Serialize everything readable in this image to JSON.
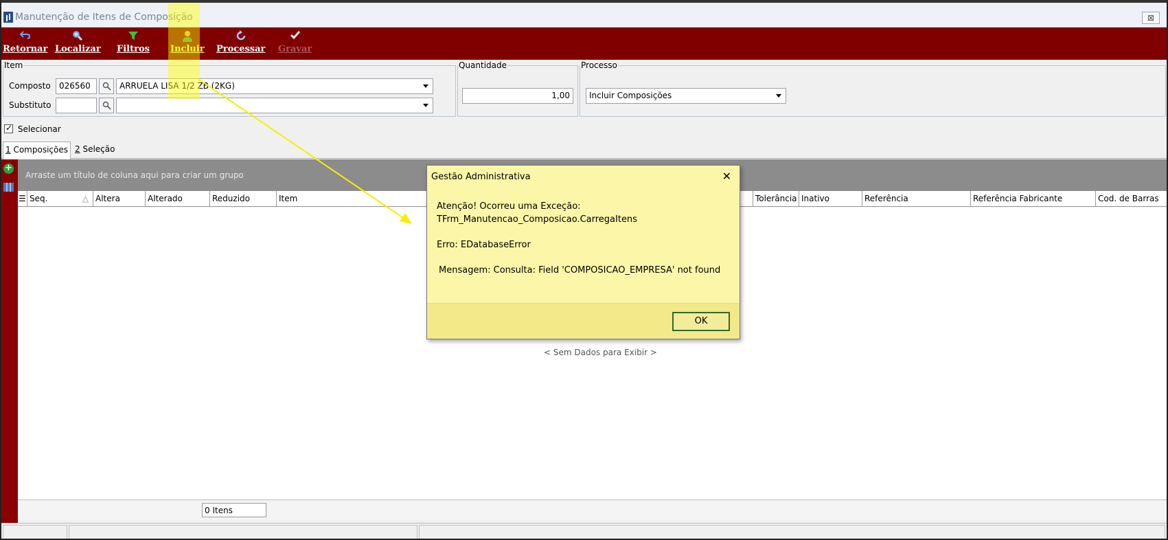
{
  "window": {
    "title": "Manutenção de Itens de Composição",
    "close_label": "⊠"
  },
  "toolbar": {
    "items": [
      {
        "label": "Retornar",
        "icon": "back-arrow-icon"
      },
      {
        "label": "Localizar",
        "icon": "magnifier-icon"
      },
      {
        "label": "Filtros",
        "icon": "funnel-icon"
      },
      {
        "label": "Incluir",
        "icon": "add-person-icon"
      },
      {
        "label": "Processar",
        "icon": "refresh-icon"
      },
      {
        "label": "Gravar",
        "icon": "checkmark-icon",
        "disabled": true
      }
    ]
  },
  "item_group": {
    "legend": "Item",
    "composto_label": "Composto",
    "composto_code": "026560",
    "composto_desc": "ARRUELA LISA 1/2 ZB (2KG)",
    "substituto_label": "Substituto",
    "substituto_code": "",
    "substituto_desc": ""
  },
  "quantidade_group": {
    "legend": "Quantidade",
    "value": "1,00"
  },
  "processo_group": {
    "legend": "Processo",
    "selected": "Incluir Composições"
  },
  "selecionar": {
    "label": "Selecionar",
    "checked": true
  },
  "tabs": [
    {
      "key": "1",
      "label": " Composições"
    },
    {
      "key": "2",
      "label": " Seleção"
    }
  ],
  "grid": {
    "group_hint": "Arraste um título de coluna aqui para criar um grupo",
    "columns": [
      "Seq.",
      "Altera",
      "Alterado",
      "Reduzido",
      "Item",
      "Tolerância",
      "Inativo",
      "Referência",
      "Referência Fabricante",
      "Cod. de Barras"
    ],
    "no_data": "< Sem Dados para Exibir >",
    "count": "0 Itens"
  },
  "dialog": {
    "title": "Gestão Administrativa",
    "close": "✕",
    "line1": "Atenção! Ocorreu uma Exceção:",
    "line2": "TFrm_Manutencao_Composicao.CarregaItens",
    "error": "Erro: EDatabaseError",
    "message": "Mensagem: Consulta: Field 'COMPOSICAO_EMPRESA' not found",
    "ok_label": "OK"
  },
  "colors": {
    "toolbar_bg": "#800000",
    "dialog_bg": "#fbf6a8",
    "highlight": "#ffff00",
    "annotation_arrow": "#f5f000"
  }
}
